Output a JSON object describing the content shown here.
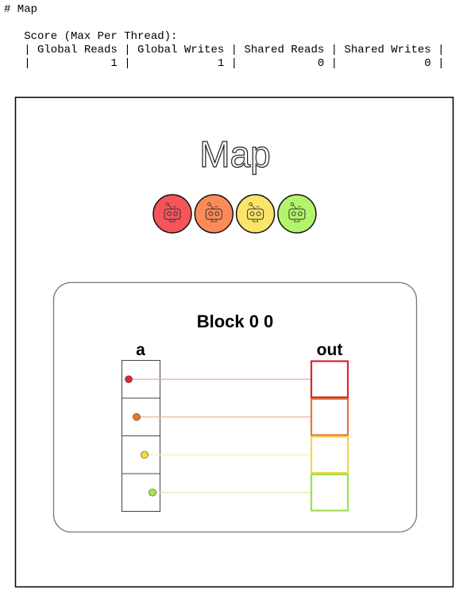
{
  "heading": "# Map",
  "score": {
    "title": "Score (Max Per Thread):",
    "columns": [
      "Global Reads",
      "Global Writes",
      "Shared Reads",
      "Shared Writes"
    ],
    "values": [
      1,
      1,
      0,
      0
    ]
  },
  "visual": {
    "title": "Map",
    "robots": [
      {
        "color": "#f6545b",
        "icon": "robot-icon"
      },
      {
        "color": "#fb8b59",
        "icon": "robot-icon"
      },
      {
        "color": "#fce46a",
        "icon": "robot-icon"
      },
      {
        "color": "#b3f56a",
        "icon": "robot-icon"
      }
    ],
    "block_title": "Block 0 0",
    "input_label": "a",
    "output_label": "out",
    "thread_colors": [
      "#e8262b",
      "#f2722c",
      "#fbd93a",
      "#a5e84a"
    ],
    "line_colors": [
      "#f4a6a0",
      "#f5b08c",
      "#faf0a8",
      "#d3f1a8"
    ],
    "output_border_colors": [
      "#d9262b",
      "#e8743a",
      "#f5d64a",
      "#9be04a"
    ]
  }
}
